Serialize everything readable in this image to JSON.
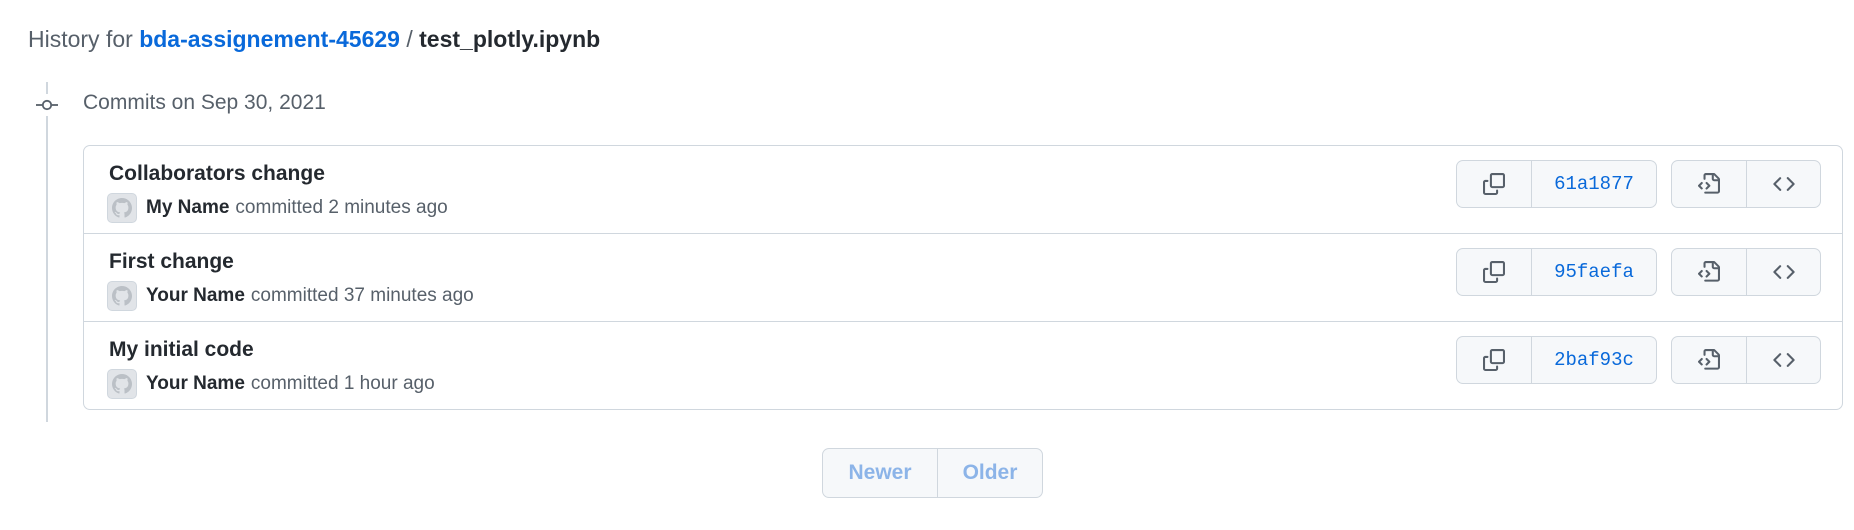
{
  "header": {
    "prefix": "History for",
    "repo": "bda-assignement-45629",
    "separator": "/",
    "filename": "test_plotly.ipynb"
  },
  "timeline": {
    "date_label": "Commits on Sep 30, 2021",
    "icon": "git-commit-icon"
  },
  "commits": [
    {
      "title": "Collaborators change",
      "author": "My Name",
      "action": "committed",
      "time": "2 minutes ago",
      "sha": "61a1877"
    },
    {
      "title": "First change",
      "author": "Your Name",
      "action": "committed",
      "time": "37 minutes ago",
      "sha": "95faefa"
    },
    {
      "title": "My initial code",
      "author": "Your Name",
      "action": "committed",
      "time": "1 hour ago",
      "sha": "2baf93c"
    }
  ],
  "icons": {
    "copy": "copy-icon",
    "browse": "file-code-icon",
    "code": "code-icon",
    "avatar": "github-mark-icon"
  },
  "pagination": {
    "newer": "Newer",
    "older": "Older"
  },
  "colors": {
    "link": "#0969da",
    "disabled": "#8cb4e8",
    "border": "#d0d7de"
  }
}
